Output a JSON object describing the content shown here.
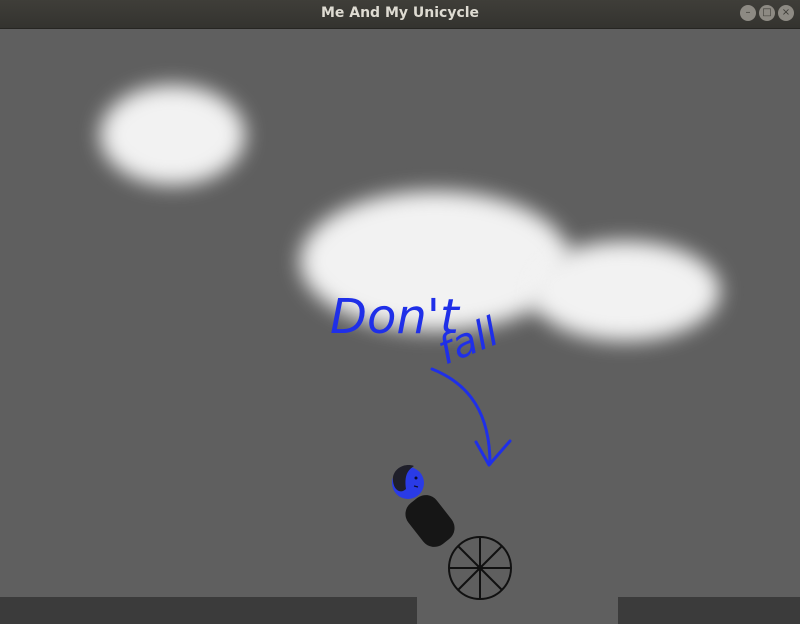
{
  "window": {
    "title": "Me And My Unicycle",
    "controls": {
      "minimize": "–",
      "maximize": "□",
      "close": "×"
    }
  },
  "scene": {
    "background_color": "#5f5f5f",
    "ground_color": "#3b3b3b",
    "cloud_color": "#f2f2f2",
    "annotation": {
      "text_line1": "Don't",
      "text_line2": "fall",
      "color": "#1f2fe8"
    },
    "character": {
      "head_color": "#2a3be6",
      "hair_color": "#1f1f2a",
      "body_color": "#161616",
      "wheel_color": "#111111"
    }
  }
}
